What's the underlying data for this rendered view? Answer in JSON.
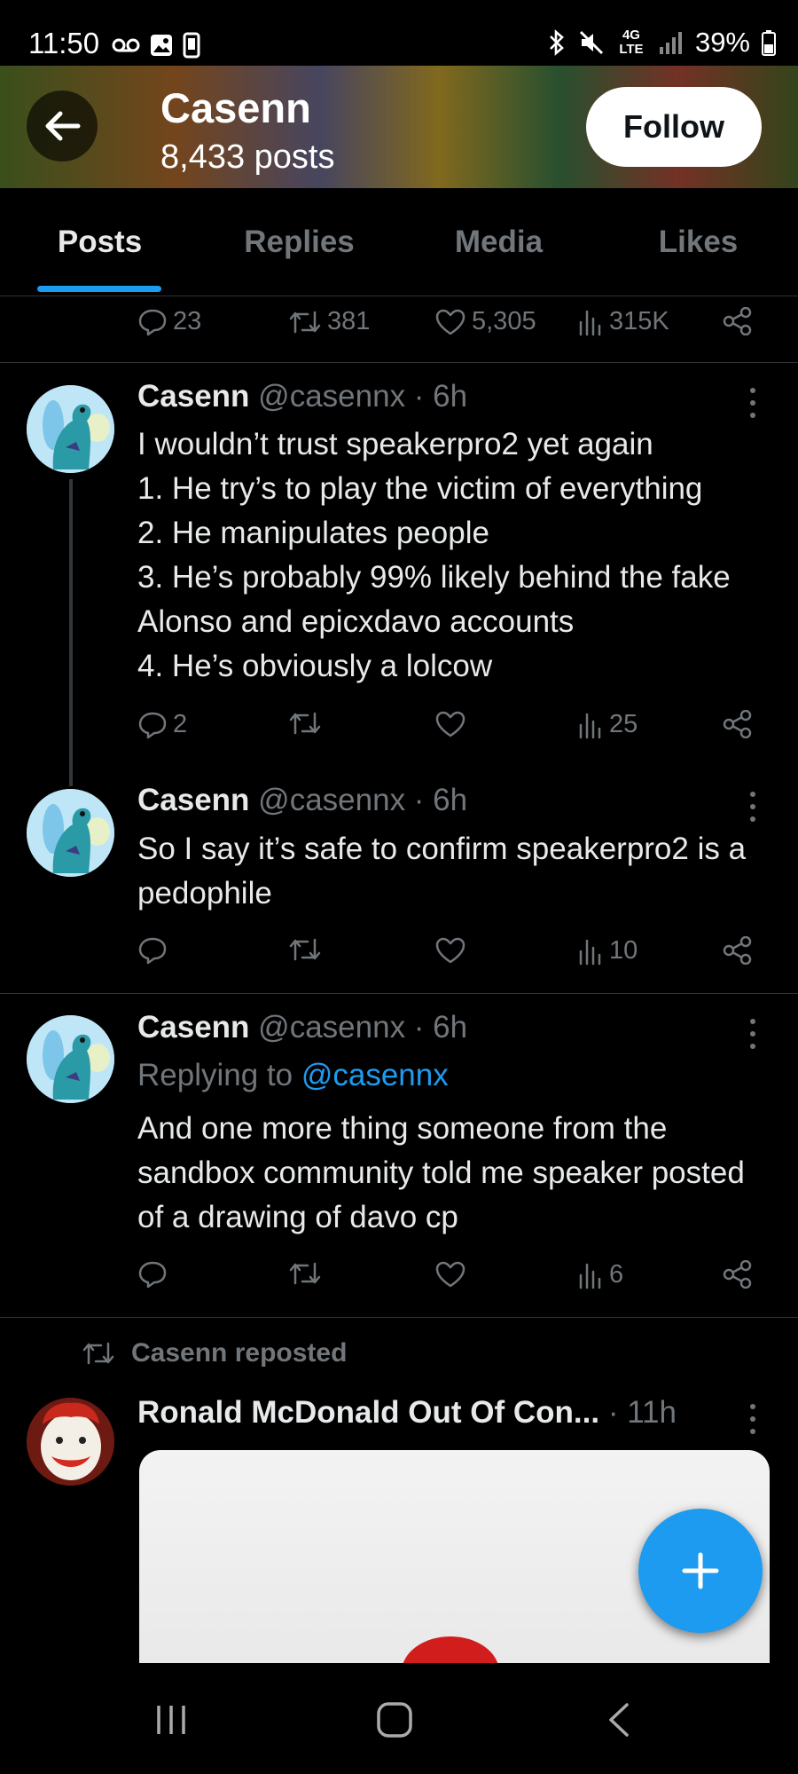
{
  "status_bar": {
    "time": "11:50",
    "battery": "39%",
    "network": "4G LTE",
    "icons": [
      "voicemail-icon",
      "image-icon",
      "phone-icon",
      "bluetooth-icon",
      "mute-icon",
      "signal-icon",
      "battery-icon"
    ]
  },
  "header": {
    "name": "Casenn",
    "posts": "8,433 posts",
    "follow_label": "Follow"
  },
  "tabs": [
    "Posts",
    "Replies",
    "Media",
    "Likes"
  ],
  "active_tab": "Posts",
  "top_actions": {
    "replies": "23",
    "reposts": "381",
    "likes": "5,305",
    "views": "315K"
  },
  "tweets": [
    {
      "name": "Casenn",
      "meta": "@casennx · 6h",
      "text": "I wouldn’t trust speakerpro2 yet again\n1. He try’s to play the victim of everything\n2. He manipulates people\n3. He’s probably 99% likely behind the fake Alonso and epicxdavo accounts\n4. He’s obviously a lolcow",
      "replies": "2",
      "views": "25"
    },
    {
      "name": "Casenn",
      "meta": "@casennx · 6h",
      "text": "So I say it’s safe to confirm speakerpro2 is a pedophile",
      "views": "10"
    },
    {
      "name": "Casenn",
      "meta": "@casennx · 6h",
      "replying_prefix": "Replying to ",
      "replying_to": "@casennx",
      "text": "And one more thing someone from the sandbox community told me speaker posted of a drawing of davo cp",
      "views": "6"
    }
  ],
  "repost": {
    "label": "Casenn reposted",
    "name": "Ronald McDonald Out Of Con...",
    "meta": "· 11h"
  },
  "colors": {
    "accent": "#1d9bf0",
    "text": "#e7e9ea",
    "muted": "#71767b",
    "divider": "#2f3336"
  }
}
